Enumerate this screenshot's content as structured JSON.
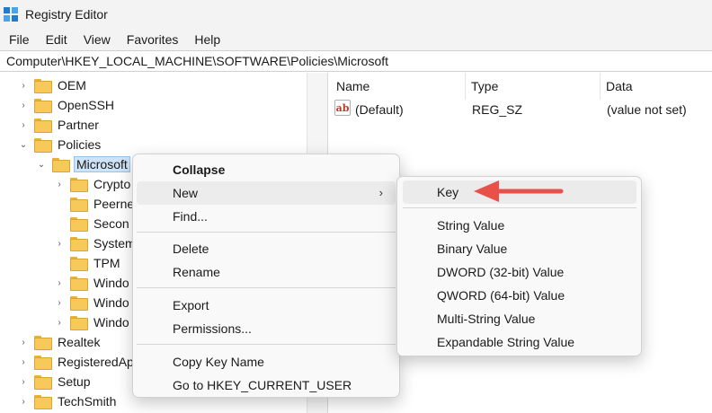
{
  "window": {
    "title": "Registry Editor"
  },
  "menubar": {
    "items": [
      "File",
      "Edit",
      "View",
      "Favorites",
      "Help"
    ]
  },
  "address": {
    "path": "Computer\\HKEY_LOCAL_MACHINE\\SOFTWARE\\Policies\\Microsoft"
  },
  "tree": {
    "items": [
      {
        "label": "OEM",
        "chevron": "right",
        "depth": 1
      },
      {
        "label": "OpenSSH",
        "chevron": "right",
        "depth": 1
      },
      {
        "label": "Partner",
        "chevron": "right",
        "depth": 1
      },
      {
        "label": "Policies",
        "chevron": "down",
        "depth": 1
      },
      {
        "label": "Microsoft",
        "chevron": "down",
        "depth": 2,
        "selected": true
      },
      {
        "label": "Crypto",
        "chevron": "right",
        "depth": 3
      },
      {
        "label": "Peerne",
        "chevron": "none",
        "depth": 3
      },
      {
        "label": "Secon",
        "chevron": "none",
        "depth": 3
      },
      {
        "label": "System",
        "chevron": "right",
        "depth": 3
      },
      {
        "label": "TPM",
        "chevron": "none",
        "depth": 3
      },
      {
        "label": "Windo",
        "chevron": "right",
        "depth": 3
      },
      {
        "label": "Windo",
        "chevron": "right",
        "depth": 3
      },
      {
        "label": "Windo",
        "chevron": "right",
        "depth": 3
      },
      {
        "label": "Realtek",
        "chevron": "right",
        "depth": 1
      },
      {
        "label": "RegisteredAp",
        "chevron": "right",
        "depth": 1
      },
      {
        "label": "Setup",
        "chevron": "right",
        "depth": 1
      },
      {
        "label": "TechSmith",
        "chevron": "right",
        "depth": 1
      }
    ]
  },
  "list": {
    "columns": [
      "Name",
      "Type",
      "Data"
    ],
    "rows": [
      {
        "name": "(Default)",
        "type": "REG_SZ",
        "data": "(value not set)",
        "icon": "ab"
      }
    ]
  },
  "context_menu": {
    "collapse": "Collapse",
    "new": "New",
    "find": "Find...",
    "delete": "Delete",
    "rename": "Rename",
    "export": "Export",
    "permissions": "Permissions...",
    "copy_key_name": "Copy Key Name",
    "goto_hkcu": "Go to HKEY_CURRENT_USER"
  },
  "submenu": {
    "key": "Key",
    "string_value": "String Value",
    "binary_value": "Binary Value",
    "dword_value": "DWORD (32-bit) Value",
    "qword_value": "QWORD (64-bit) Value",
    "multi_string_value": "Multi-String Value",
    "expandable_string_value": "Expandable String Value"
  },
  "colors": {
    "arrow": "#e8504a",
    "selection": "#cfe3f7",
    "folder": "#f7c95b"
  }
}
